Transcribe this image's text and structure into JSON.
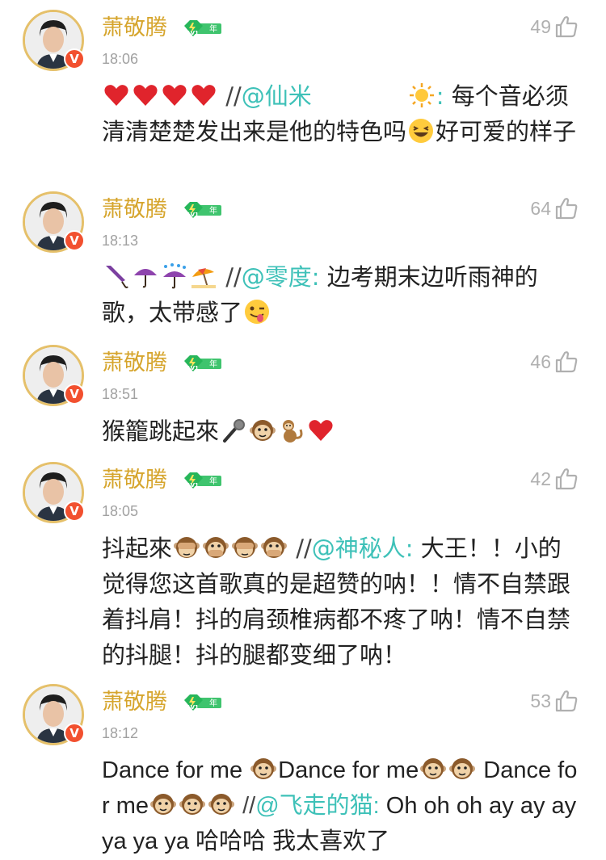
{
  "badge": {
    "level": "LV1",
    "suffix": "年"
  },
  "comments": [
    {
      "user": "萧敬腾",
      "time": "18:06",
      "likes": "49",
      "prefix_emojis": [
        "heart-icon",
        "heart-icon",
        "heart-icon",
        "heart-icon"
      ],
      "mention": "@仙米",
      "mention_emojis": [
        "sun-icon"
      ],
      "text": "每个音必须清清楚楚发出来是他的特色吗",
      "tail_emojis": [
        "laughing-face-icon"
      ],
      "tail_text": "好可爱的样子"
    },
    {
      "user": "萧敬腾",
      "time": "18:13",
      "likes": "64",
      "prefix_emojis": [
        "closed-umbrella-icon",
        "umbrella-icon",
        "umbrella-rain-icon",
        "beach-umbrella-icon"
      ],
      "mention": "@零度",
      "mention_emojis": [],
      "text": "边考期末边听雨神的歌，太带感了",
      "tail_emojis": [
        "winking-tongue-face-icon"
      ],
      "tail_text": ""
    },
    {
      "user": "萧敬腾",
      "time": "18:51",
      "likes": "46",
      "text": "猴籠跳起來",
      "emojis": [
        "microphone-icon",
        "monkey-face-icon",
        "monkey-icon",
        "heart-icon"
      ]
    },
    {
      "user": "萧敬腾",
      "time": "18:05",
      "likes": "42",
      "lead_text": "抖起來",
      "prefix_emojis": [
        "see-no-evil-monkey-icon",
        "speak-no-evil-monkey-icon",
        "see-no-evil-monkey-icon",
        "speak-no-evil-monkey-icon"
      ],
      "mention": "@神秘人",
      "text": "大王！！小的觉得您这首歌真的是超赞的呐！！情不自禁跟着抖肩！抖的肩颈椎病都不疼了呐！情不自禁的抖腿！抖的腿都变细了呐！"
    },
    {
      "user": "萧敬腾",
      "time": "18:12",
      "likes": "53",
      "line1": "Dance for me",
      "line2": "Dance for me",
      "line3": "Dance for me",
      "mention": "@飞走的猫",
      "text": "Oh oh oh ay ay ay ya ya ya 哈哈哈 我太喜欢了"
    }
  ]
}
